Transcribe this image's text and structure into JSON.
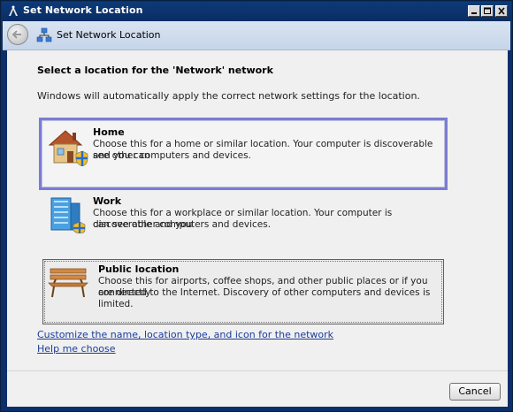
{
  "window": {
    "title": "Set Network Location",
    "caption_buttons": [
      "minimize",
      "maximize",
      "close"
    ]
  },
  "navbar": {
    "back_icon": "back-arrow-icon",
    "icon": "network-icon",
    "title": "Set Network Location"
  },
  "main": {
    "heading": "Select a location for the 'Network' network",
    "intro": "Windows will automatically apply the correct network settings for the location.",
    "options": [
      {
        "icon": "house-icon",
        "title": "Home",
        "desc_line1": "Choose this for a home or similar location. Your computer is discoverable and you can",
        "desc_line2": "see other computers and devices.",
        "selected": true
      },
      {
        "icon": "office-building-icon",
        "title": "Work",
        "desc_line1": "Choose this for a workplace or similar location. Your computer is discoverable and you",
        "desc_line2": "can see other computers and devices.",
        "selected": false
      },
      {
        "icon": "park-bench-icon",
        "title": "Public location",
        "desc_line1": "Choose this for airports, coffee shops, and other public places or if you are directly",
        "desc_line2": "connected to the Internet. Discovery of other computers and devices is limited.",
        "selected": false
      }
    ],
    "links": {
      "customize": "Customize the name, location type, and icon for the network",
      "help": "Help me choose"
    }
  },
  "footer": {
    "cancel_label": "Cancel"
  },
  "colors": {
    "titlebar": "#0d3a78",
    "selection_border": "#7b7bd8",
    "link": "#1a3c9c"
  }
}
